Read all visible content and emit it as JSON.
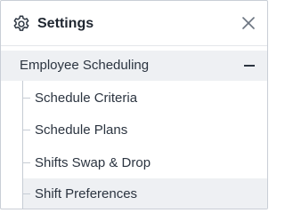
{
  "header": {
    "title": "Settings",
    "settings_icon": "gear-icon",
    "close_icon": "close-icon"
  },
  "section": {
    "label": "Employee Scheduling",
    "expanded": true,
    "toggle_icon": "minus-icon"
  },
  "items": [
    {
      "label": "Schedule Criteria",
      "active": false
    },
    {
      "label": "Schedule Plans",
      "active": false
    },
    {
      "label": "Shifts Swap & Drop",
      "active": false
    },
    {
      "label": "Shift Preferences",
      "active": true
    }
  ],
  "colors": {
    "border": "#c9ced6",
    "highlight": "#eef0f3",
    "text": "#2b3440"
  }
}
